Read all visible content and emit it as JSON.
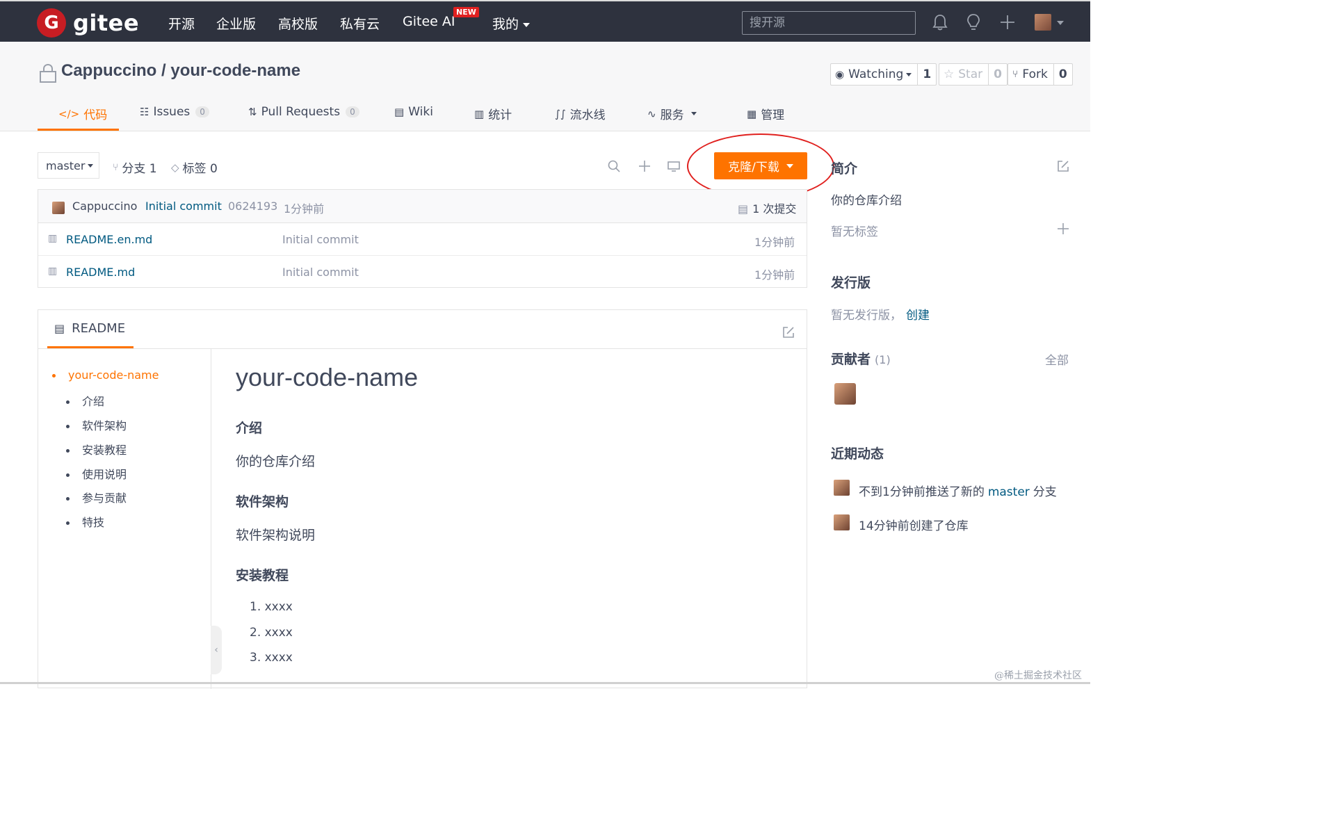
{
  "topnav": {
    "logo_letter": "G",
    "logo_text": "gitee",
    "items": [
      "开源",
      "企业版",
      "高校版",
      "私有云",
      "Gitee AI",
      "我的"
    ],
    "new_badge": "NEW",
    "search_placeholder": "搜开源"
  },
  "repo": {
    "title": "Cappuccino / your-code-name",
    "watching_label": "Watching",
    "watching_count": "1",
    "star_label": "Star",
    "star_count": "0",
    "fork_label": "Fork",
    "fork_count": "0"
  },
  "tabs": [
    {
      "label": "代码",
      "icon": "code-icon"
    },
    {
      "label": "Issues",
      "badge": "0",
      "icon": "issues-icon"
    },
    {
      "label": "Pull Requests",
      "badge": "0",
      "icon": "pull-request-icon"
    },
    {
      "label": "Wiki",
      "icon": "wiki-icon"
    },
    {
      "label": "统计",
      "icon": "stats-icon"
    },
    {
      "label": "流水线",
      "icon": "pipeline-icon"
    },
    {
      "label": "服务",
      "icon": "service-icon"
    },
    {
      "label": "管理",
      "icon": "manage-icon"
    }
  ],
  "branch": {
    "current": "master",
    "branches": "分支 1",
    "tags": "标签 0",
    "clone_label": "克隆/下载"
  },
  "commit": {
    "author": "Cappuccino",
    "message": "Initial commit",
    "hash": "0624193",
    "time": "1分钟前",
    "count": "1 次提交"
  },
  "files": [
    {
      "name": "README.en.md",
      "commit": "Initial commit",
      "time": "1分钟前"
    },
    {
      "name": "README.md",
      "commit": "Initial commit",
      "time": "1分钟前"
    }
  ],
  "readme": {
    "tab_label": "README",
    "toc": [
      "your-code-name",
      "介绍",
      "软件架构",
      "安装教程",
      "使用说明",
      "参与贡献",
      "特技"
    ],
    "h1": "your-code-name",
    "intro_h": "介绍",
    "intro_p": "你的仓库介绍",
    "arch_h": "软件架构",
    "arch_p": "软件架构说明",
    "install_h": "安装教程",
    "install_steps": [
      "1. xxxx",
      "2. xxxx",
      "3. xxxx"
    ]
  },
  "sidebar": {
    "about_title": "简介",
    "about_text": "你的仓库介绍",
    "no_tags": "暂无标签",
    "release_title": "发行版",
    "no_release": "暂无发行版，",
    "create_link": "创建",
    "contrib_title": "贡献者",
    "contrib_count": "(1)",
    "contrib_all": "全部",
    "activity_title": "近期动态",
    "activity_1_pre": "不到1分钟前推送了新的",
    "activity_1_branch": "master",
    "activity_1_post": "分支",
    "activity_2": "14分钟前创建了仓库"
  },
  "watermark": "@稀土掘金技术社区",
  "colors": {
    "accent": "#fe7300",
    "topbar": "#2e323e",
    "link": "#005980",
    "annotation": "#e0201e"
  }
}
